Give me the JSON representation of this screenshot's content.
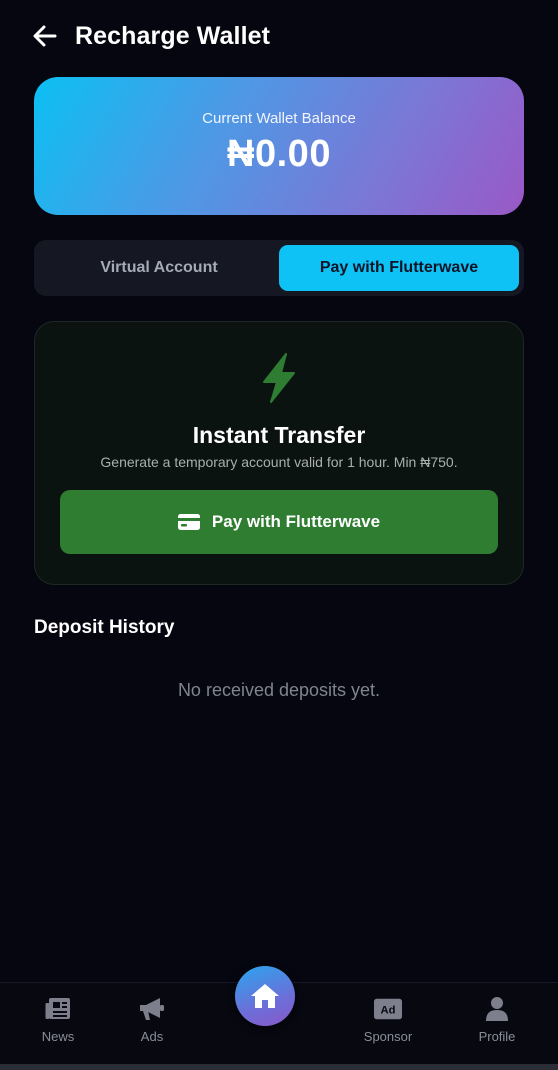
{
  "header": {
    "title": "Recharge Wallet",
    "back_icon": "arrow-left-icon"
  },
  "balance": {
    "label": "Current Wallet Balance",
    "value": "₦0.00"
  },
  "tabs": [
    {
      "label": "Virtual Account",
      "active": false
    },
    {
      "label": "Pay with Flutterwave",
      "active": true
    }
  ],
  "transfer": {
    "icon": "lightning-bolt-icon",
    "title": "Instant Transfer",
    "description": "Generate a temporary account valid for 1 hour. Min ₦750.",
    "button_label": "Pay with Flutterwave",
    "button_icon": "credit-card-icon"
  },
  "history": {
    "title": "Deposit History",
    "empty_message": "No received deposits yet."
  },
  "nav": {
    "items": [
      {
        "label": "News",
        "icon": "newspaper-icon"
      },
      {
        "label": "Ads",
        "icon": "megaphone-icon"
      },
      {
        "label": "Sponsor",
        "icon": "ad-badge-icon"
      },
      {
        "label": "Profile",
        "icon": "user-icon"
      }
    ],
    "home_icon": "home-icon"
  },
  "colors": {
    "background": "#05060f",
    "accent": "#0fc2f5",
    "pay_button": "#2f7d31",
    "bolt": "#2e7d32"
  }
}
